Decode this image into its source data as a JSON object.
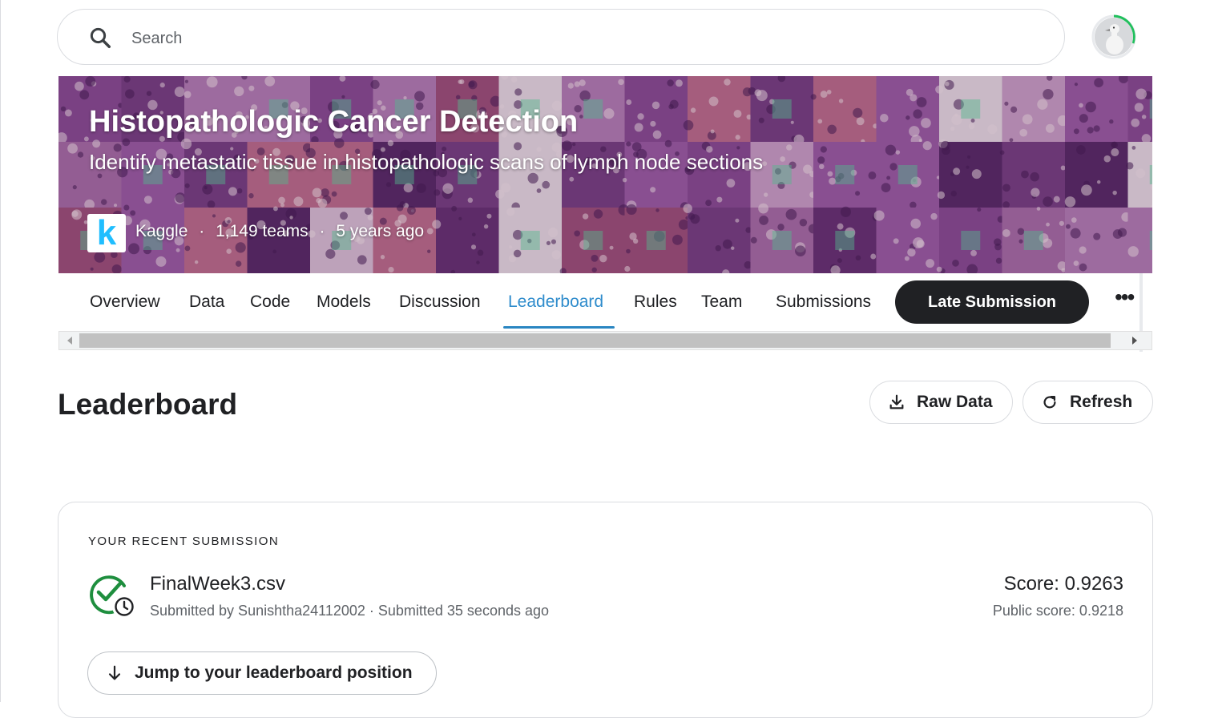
{
  "search": {
    "placeholder": "Search"
  },
  "competition": {
    "title": "Histopathologic Cancer Detection",
    "subtitle": "Identify metastatic tissue in histopathologic scans of lymph node sections",
    "host_logo": "k",
    "host": "Kaggle",
    "separator": "·",
    "teams": "1,149 teams",
    "age": "5 years ago"
  },
  "tabs": [
    {
      "label": "Overview"
    },
    {
      "label": "Data"
    },
    {
      "label": "Code"
    },
    {
      "label": "Models"
    },
    {
      "label": "Discussion"
    },
    {
      "label": "Leaderboard",
      "active": true
    },
    {
      "label": "Rules"
    },
    {
      "label": "Team"
    },
    {
      "label": "Submissions"
    }
  ],
  "late_submission_label": "Late Submission",
  "more_label": "•••",
  "leaderboard": {
    "title": "Leaderboard",
    "raw_data_label": "Raw Data",
    "refresh_label": "Refresh"
  },
  "recent_submission": {
    "heading": "YOUR RECENT SUBMISSION",
    "filename": "FinalWeek3.csv",
    "byline": "Submitted by Sunishtha24112002 · Submitted 35 seconds ago",
    "score": "Score: 0.9263",
    "public_score": "Public score: 0.9218",
    "jump_label": "Jump to your leaderboard position"
  },
  "colors": {
    "accent": "#2a86c2",
    "dark_button": "#202124",
    "success": "#1e8e3e",
    "kaggle_blue": "#20beff"
  },
  "icons": {
    "search": "search-icon",
    "download": "download-icon",
    "refresh": "refresh-icon",
    "status": "check-clock-icon",
    "arrow_down": "arrow-down-icon",
    "more": "more-horizontal-icon"
  }
}
